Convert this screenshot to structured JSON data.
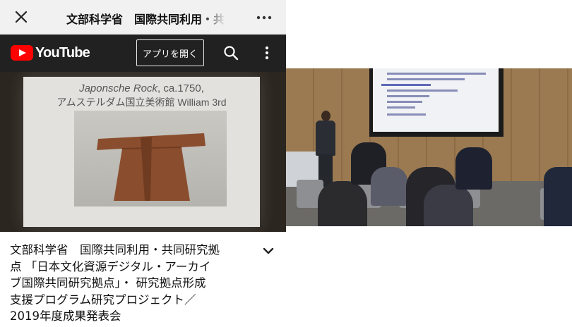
{
  "topbar": {
    "title": "文部科学省　国際共同利用・共同研究拠点",
    "close_icon": "close-icon",
    "more_icon": "more-horizontal-icon"
  },
  "youtube": {
    "logo_text": "YouTube",
    "open_app_label": "アプリを開く",
    "search_icon": "search-icon",
    "menu_icon": "more-vertical-icon",
    "brand_color": "#ff0000",
    "bar_color": "#212121"
  },
  "video": {
    "slide_caption_italic": "Japonsche Rock",
    "slide_caption_rest": ", ca.1750,",
    "slide_caption_line2": "アムステルダム国立美術館 William 3rd"
  },
  "description": {
    "lines": [
      "文部科学省　国際共同利用・共同研究拠",
      "点 「日本文化資源デジタル・アーカイ",
      "ブ国際共同研究拠点」・ 研究拠点形成",
      "支援プログラム研究プロジェクト／",
      "2019年度成果発表会"
    ],
    "expand_icon": "chevron-down-icon"
  }
}
